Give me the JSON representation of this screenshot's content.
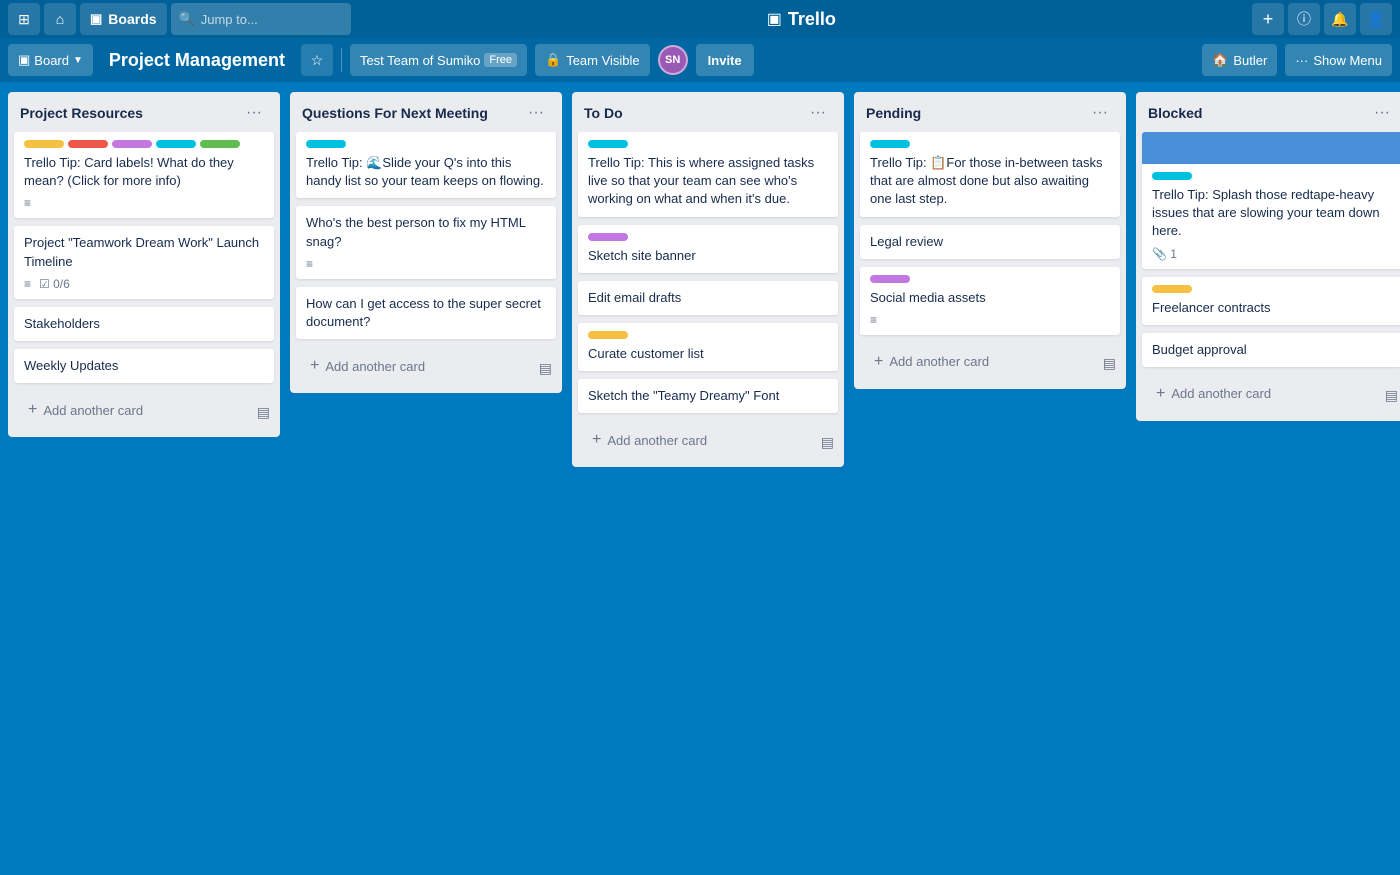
{
  "topNav": {
    "gridIcon": "⊞",
    "homeIcon": "⌂",
    "boardsLabel": "Boards",
    "searchPlaceholder": "Jump to...",
    "appName": "Trello",
    "appIcon": "▣",
    "plusIcon": "+",
    "infoIcon": "ⓘ",
    "bellIcon": "🔔",
    "userIcon": "👤"
  },
  "boardHeader": {
    "boardIcon": "▣",
    "boardDropdownLabel": "Board",
    "title": "Project Management",
    "starIcon": "☆",
    "teamName": "Test Team of Sumiko",
    "teamBadge": "Free",
    "teamVisibleLabel": "Team Visible",
    "teamVisibleIcon": "🔒",
    "avatarText": "SN",
    "inviteLabel": "Invite",
    "butlerIcon": "🏠",
    "butlerLabel": "Butler",
    "menuDotsIcon": "···",
    "showMenuLabel": "Show Menu"
  },
  "lists": [
    {
      "id": "project-resources",
      "title": "Project Resources",
      "cards": [
        {
          "id": "tip-labels",
          "labels": [
            "#f6c142",
            "#eb5a46",
            "#c377e0",
            "#00c2e0",
            "#61bd4f"
          ],
          "text": "Trello Tip: Card labels! What do they mean? (Click for more info)",
          "hasDescription": true
        },
        {
          "id": "launch-timeline",
          "labels": [],
          "text": "Project \"Teamwork Dream Work\" Launch Timeline",
          "hasDescription": true,
          "hasChecklist": true,
          "checklistText": "0/6"
        },
        {
          "id": "stakeholders",
          "labels": [],
          "text": "Stakeholders",
          "hasDescription": false
        },
        {
          "id": "weekly-updates",
          "labels": [],
          "text": "Weekly Updates",
          "hasDescription": false
        }
      ],
      "addCardLabel": "Add another card"
    },
    {
      "id": "questions-next-meeting",
      "title": "Questions For Next Meeting",
      "cards": [
        {
          "id": "tip-slide",
          "labels": [
            "#00c2e0"
          ],
          "text": "Trello Tip: 🌊Slide your Q's into this handy list so your team keeps on flowing.",
          "hasDescription": false
        },
        {
          "id": "html-snag",
          "labels": [],
          "text": "Who's the best person to fix my HTML snag?",
          "hasDescription": true
        },
        {
          "id": "secret-document",
          "labels": [],
          "text": "How can I get access to the super secret document?",
          "hasDescription": false
        }
      ],
      "addCardLabel": "Add another card"
    },
    {
      "id": "to-do",
      "title": "To Do",
      "cards": [
        {
          "id": "tip-assigned",
          "labels": [
            "#00c2e0"
          ],
          "text": "Trello Tip: This is where assigned tasks live so that your team can see who's working on what and when it's due.",
          "hasDescription": false
        },
        {
          "id": "sketch-banner",
          "labels": [
            "#c377e0"
          ],
          "text": "Sketch site banner",
          "hasDescription": false
        },
        {
          "id": "edit-email-drafts",
          "labels": [],
          "text": "Edit email drafts",
          "hasDescription": false
        },
        {
          "id": "curate-customer",
          "labels": [
            "#f6c142"
          ],
          "text": "Curate customer list",
          "hasDescription": false
        },
        {
          "id": "sketch-font",
          "labels": [],
          "text": "Sketch the \"Teamy Dreamy\" Font",
          "hasDescription": false
        }
      ],
      "addCardLabel": "Add another card"
    },
    {
      "id": "pending",
      "title": "Pending",
      "cards": [
        {
          "id": "tip-inbetween",
          "labels": [
            "#00c2e0"
          ],
          "text": "Trello Tip: 📋For those in-between tasks that are almost done but also awaiting one last step.",
          "hasDescription": false
        },
        {
          "id": "legal-review",
          "labels": [],
          "text": "Legal review",
          "hasDescription": false
        },
        {
          "id": "social-media",
          "labels": [
            "#c377e0"
          ],
          "text": "Social media assets",
          "hasDescription": true
        }
      ],
      "addCardLabel": "Add another card"
    },
    {
      "id": "blocked",
      "title": "Blocked",
      "cards": [
        {
          "id": "tip-redtape",
          "labels": [
            "#00c2e0"
          ],
          "blueHeader": true,
          "text": "Trello Tip: Splash those redtape-heavy issues that are slowing your team down here.",
          "hasAttachment": true,
          "attachmentCount": "1"
        },
        {
          "id": "freelancer-contracts",
          "labels": [
            "#f6c142"
          ],
          "text": "Freelancer contracts",
          "hasDescription": false
        },
        {
          "id": "budget-approval",
          "labels": [],
          "text": "Budget approval",
          "hasDescription": false
        }
      ],
      "addCardLabel": "Add another card"
    }
  ]
}
